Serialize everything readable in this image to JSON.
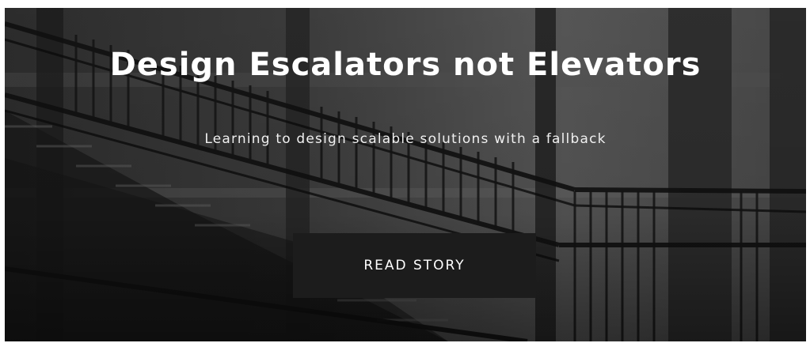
{
  "hero": {
    "title": "Design Escalators not Elevators",
    "subtitle": "Learning to design scalable solutions with a fallback",
    "cta_label": "READ STORY",
    "background_image": "stairway-railings-photo"
  },
  "colors": {
    "title_text": "#ffffff",
    "cta_background": "#1c1c1c",
    "cta_text": "#ffffff"
  }
}
